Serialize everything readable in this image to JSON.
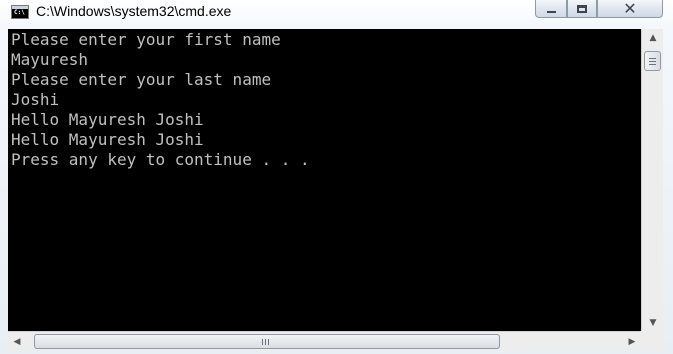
{
  "window": {
    "title": "C:\\Windows\\system32\\cmd.exe",
    "app_icon_text": "C:\\"
  },
  "console": {
    "lines": [
      "Please enter your first name",
      "Mayuresh",
      "Please enter your last name",
      "Joshi",
      "Hello Mayuresh Joshi",
      "Hello Mayuresh Joshi",
      "Press any key to continue . . ."
    ],
    "text_color": "#c0c0c0",
    "background_color": "#000000"
  },
  "scrollbars": {
    "vertical_position": 0.0,
    "horizontal_position": 0.0
  }
}
